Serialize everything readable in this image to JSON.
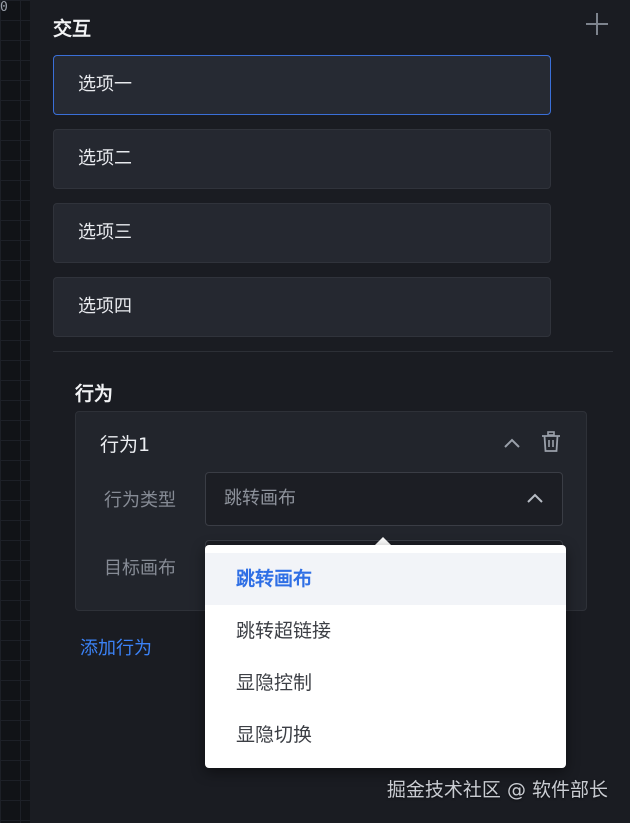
{
  "ruler": {
    "number": "0"
  },
  "interaction": {
    "title": "交互",
    "options": [
      "选项一",
      "选项二",
      "选项三",
      "选项四"
    ]
  },
  "behavior": {
    "title": "行为",
    "card_title": "行为1",
    "type_label": "行为类型",
    "type_value": "跳转画布",
    "target_label": "目标画布",
    "add_label": "添加行为"
  },
  "dropdown": {
    "items": [
      "跳转画布",
      "跳转超链接",
      "显隐控制",
      "显隐切换"
    ],
    "selected": "跳转画布"
  },
  "watermark": "掘金技术社区 @ 软件部长",
  "colors": {
    "accent": "#3b82f6",
    "selected_border": "#3a6fd8",
    "background": "#1a1c22"
  },
  "icons": [
    "plus-icon",
    "chevron-up-icon",
    "trash-icon",
    "chevron-up-icon"
  ]
}
